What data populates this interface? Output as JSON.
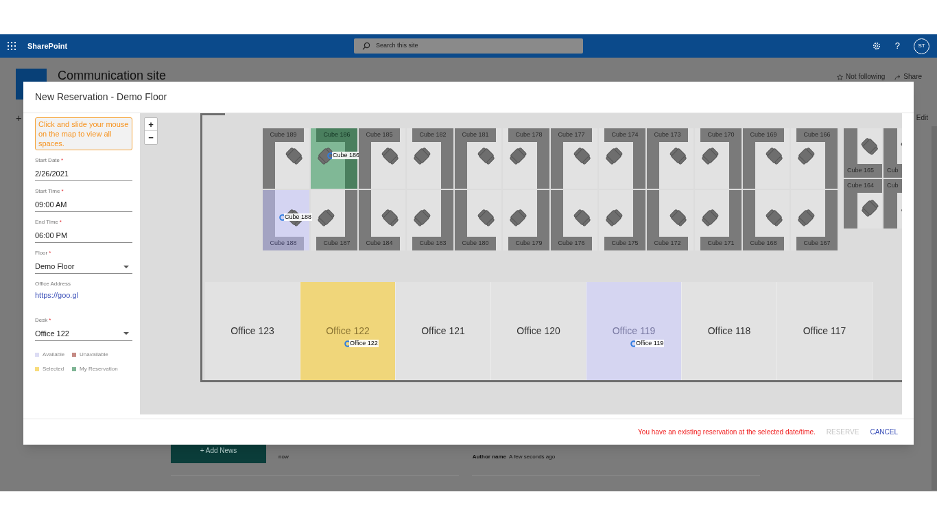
{
  "top_bar": {
    "app_name": "SharePoint",
    "search_placeholder": "Search this site",
    "help": "?",
    "avatar": "ST"
  },
  "site": {
    "title": "Communication site",
    "follow": "Not following",
    "share": "Share",
    "new": "+",
    "edit": "Edit"
  },
  "news": {
    "add_button": "Add News",
    "add_mark": "+",
    "time": "now",
    "author": "Author name",
    "posted": "A few seconds ago"
  },
  "dialog": {
    "title": "New Reservation - Demo Floor",
    "hint": "Click and slide your mouse on the map to view all spaces.",
    "fields": [
      {
        "kind": "text",
        "label": "Start Date",
        "mark": "*",
        "value": "2/26/2021"
      },
      {
        "kind": "text",
        "label": "Start Time",
        "mark": "*",
        "value": "09:00 AM"
      },
      {
        "kind": "text",
        "label": "End Time",
        "mark": "*",
        "value": "06:00 PM"
      },
      {
        "kind": "select",
        "label": "Floor",
        "mark": "*",
        "value": "Demo Floor"
      },
      {
        "kind": "link",
        "label": "Office Address",
        "value": "https://goo.gl"
      },
      {
        "kind": "select",
        "label": "Desk",
        "mark": "*",
        "value": "Office 122"
      }
    ],
    "legend": [
      {
        "label": "Available",
        "color": "#dcdcf4"
      },
      {
        "label": "Unavailable",
        "color": "#c58a84"
      },
      {
        "label": "Selected",
        "color": "#f8dc7c"
      },
      {
        "label": "My Reservation",
        "color": "#7fb595"
      }
    ],
    "map": {
      "zoom_in": "+",
      "zoom_out": "−",
      "cube_columns": [
        {
          "top": {
            "label": "Cube 189",
            "available": false,
            "mine": false
          },
          "bottom": {
            "label": "Cube 188",
            "available": true,
            "mine": false,
            "marker": "Cube 188"
          }
        },
        {
          "top": {
            "label": "Cube 186",
            "available": false,
            "mine": true,
            "marker": "Cube 186"
          },
          "bottom": {
            "label": "Cube 187",
            "available": false,
            "mine": false
          }
        },
        {
          "top": {
            "label": "Cube 185",
            "available": false,
            "mine": false
          },
          "bottom": {
            "label": "Cube 184",
            "available": false,
            "mine": false
          }
        },
        {
          "top": {
            "label": "Cube 182",
            "available": false,
            "mine": false
          },
          "bottom": {
            "label": "Cube 183",
            "available": false,
            "mine": false
          }
        },
        {
          "top": {
            "label": "Cube 181",
            "available": false,
            "mine": false
          },
          "bottom": {
            "label": "Cube 180",
            "available": false,
            "mine": false
          }
        },
        {
          "top": {
            "label": "Cube 178",
            "available": false,
            "mine": false
          },
          "bottom": {
            "label": "Cube 179",
            "available": false,
            "mine": false
          }
        },
        {
          "top": {
            "label": "Cube 177",
            "available": false,
            "mine": false
          },
          "bottom": {
            "label": "Cube 176",
            "available": false,
            "mine": false
          }
        },
        {
          "top": {
            "label": "Cube 174",
            "available": false,
            "mine": false
          },
          "bottom": {
            "label": "Cube 175",
            "available": false,
            "mine": false
          }
        },
        {
          "top": {
            "label": "Cube 173",
            "available": false,
            "mine": false
          },
          "bottom": {
            "label": "Cube 172",
            "available": false,
            "mine": false
          }
        },
        {
          "top": {
            "label": "Cube 170",
            "available": false,
            "mine": false
          },
          "bottom": {
            "label": "Cube 171",
            "available": false,
            "mine": false
          }
        },
        {
          "top": {
            "label": "Cube 169",
            "available": false,
            "mine": false
          },
          "bottom": {
            "label": "Cube 168",
            "available": false,
            "mine": false
          }
        },
        {
          "top": {
            "label": "Cube 166",
            "available": false,
            "mine": false
          },
          "bottom": {
            "label": "Cube 167",
            "available": false,
            "mine": false
          }
        }
      ],
      "side_cubes": [
        {
          "top": "Cube 165",
          "bottom": "Cube 164"
        },
        {
          "top": "Cub",
          "bottom": "Cub"
        }
      ],
      "offices": [
        {
          "label": "Office 123",
          "selected": false,
          "available": false
        },
        {
          "label": "Office 122",
          "selected": true,
          "available": false,
          "marker": "Office 122"
        },
        {
          "label": "Office 121",
          "selected": false,
          "available": false
        },
        {
          "label": "Office 120",
          "selected": false,
          "available": false
        },
        {
          "label": "Office 119",
          "selected": false,
          "available": true,
          "marker": "Office 119"
        },
        {
          "label": "Office 118",
          "selected": false,
          "available": false
        },
        {
          "label": "Office 117",
          "selected": false,
          "available": false
        }
      ]
    },
    "footer": {
      "message": "You have an existing reservation at the selected date/time.",
      "reserve": {
        "label": "RESERVE",
        "disabled": true
      },
      "cancel": "CANCEL"
    }
  }
}
